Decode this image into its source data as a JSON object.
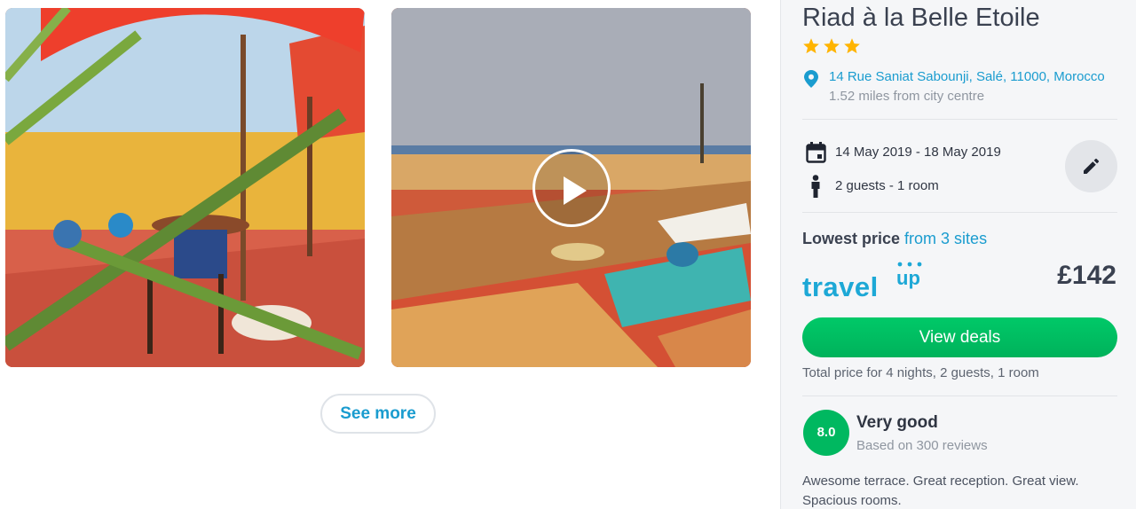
{
  "gallery": {
    "photos": [
      {
        "name": "terrace-photo",
        "type": "image"
      },
      {
        "name": "sea-view-video",
        "type": "video"
      }
    ],
    "see_more_label": "See more"
  },
  "hotel": {
    "name": "Riad à la Belle Etoile",
    "star_rating": 3,
    "address": "14 Rue Saniat Sabounji, Salé, 11000, Morocco",
    "distance": "1.52 miles from city centre"
  },
  "booking": {
    "dates": "14 May 2019 - 18 May 2019",
    "guests": "2 guests - 1 room",
    "edit_icon": "pencil-icon"
  },
  "pricing": {
    "lowest_label": "Lowest price",
    "sites_label": "from 3 sites",
    "provider_word": "travel",
    "provider_sup": "up",
    "price": "£142",
    "cta_label": "View deals",
    "total_note": "Total price for 4 nights, 2 guests, 1 room"
  },
  "rating": {
    "score": "8.0",
    "label": "Very good",
    "count": "Based on 300 reviews",
    "summary": "Awesome terrace. Great reception. Great view. Spacious rooms."
  },
  "colors": {
    "accent_blue": "#1a9ccf",
    "cta_green": "#00b860",
    "star_yellow": "#ffb400"
  }
}
